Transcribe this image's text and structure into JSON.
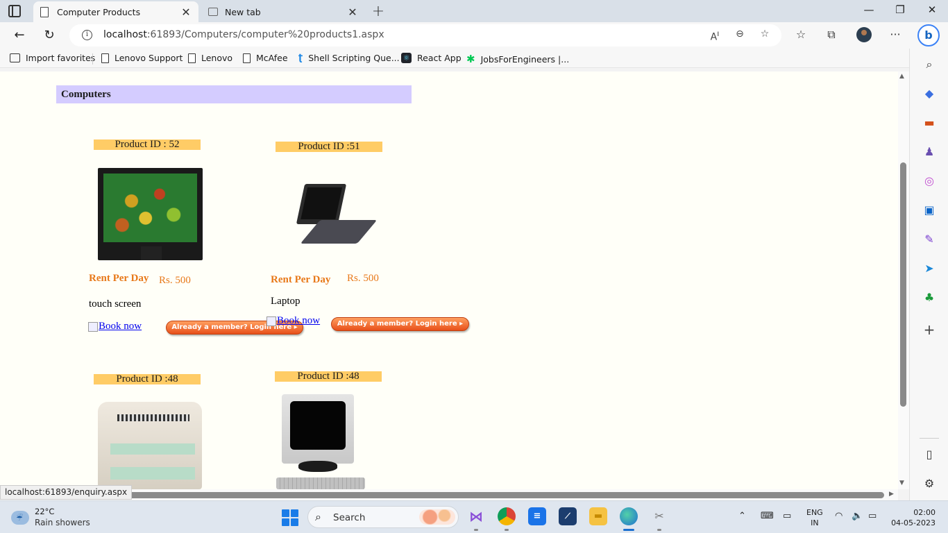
{
  "browser": {
    "tabs": [
      {
        "title": "Computer Products",
        "active": true
      },
      {
        "title": "New tab",
        "active": false
      }
    ],
    "url_host": "localhost",
    "url_rest": ":61893/Computers/computer%20products1.aspx",
    "favorites": [
      {
        "label": "Import favorites",
        "icon": "import-icon"
      },
      {
        "label": "Lenovo Support",
        "icon": "page-icon"
      },
      {
        "label": "Lenovo",
        "icon": "page-icon"
      },
      {
        "label": "McAfee",
        "icon": "page-icon"
      },
      {
        "label": "Shell Scripting Que...",
        "icon": "shell-icon"
      },
      {
        "label": "React App",
        "icon": "react-icon"
      },
      {
        "label": "JobsForEngineers |...",
        "icon": "jobs-icon"
      }
    ],
    "status_url": "localhost:61893/enquiry.aspx"
  },
  "page": {
    "header": "Computers",
    "products": [
      {
        "id_label": "Product ID : 52",
        "rent_label": "Rent Per Day",
        "rent_value": "Rs. 500",
        "description": "touch screen",
        "book_label": "Book now",
        "login_label": "Already a member? Login here",
        "image": "lcd-monitor"
      },
      {
        "id_label": "Product ID :51",
        "rent_label": "Rent Per Day",
        "rent_value": "Rs. 500",
        "description": "Laptop",
        "book_label": "Book now",
        "login_label": "Already a member? Login here",
        "image": "laptop"
      },
      {
        "id_label": "Product ID :48",
        "image": "printer"
      },
      {
        "id_label": "Product ID :48",
        "image": "crt-computer"
      }
    ]
  },
  "taskbar": {
    "weather_temp": "22°C",
    "weather_condition": "Rain showers",
    "search_label": "Search",
    "lang_top": "ENG",
    "lang_bottom": "IN",
    "time": "02:00",
    "date": "04-05-2023"
  },
  "colors": {
    "header_bg": "#d4ccff",
    "product_id_bg": "#ffcc66",
    "rent_text": "#e8791a",
    "link": "#0000ee",
    "page_bg": "#fffff8"
  }
}
